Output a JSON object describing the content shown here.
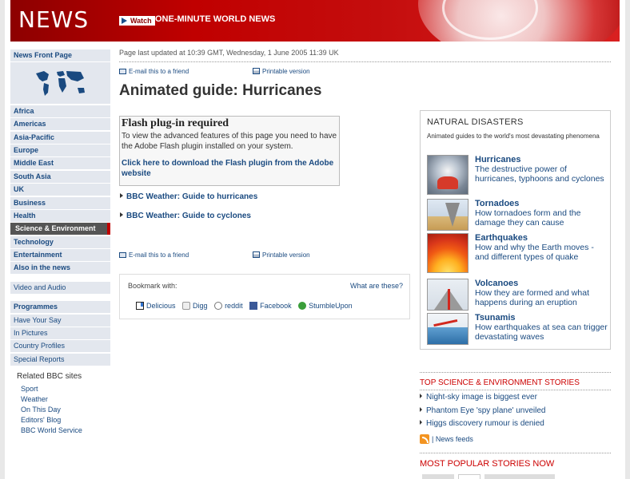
{
  "banner": {
    "logo": "NEWS",
    "watch_label": "Watch",
    "title": "ONE-MINUTE WORLD NEWS"
  },
  "leftnav": {
    "front_page": "News Front Page",
    "sections": [
      "Africa",
      "Americas",
      "Asia-Pacific",
      "Europe",
      "Middle East",
      "South Asia",
      "UK",
      "Business",
      "Health",
      "Science & Environment",
      "Technology",
      "Entertainment",
      "Also in the news"
    ],
    "active": "Science & Environment",
    "video": "Video and Audio",
    "extras": [
      "Programmes",
      "Have Your Say",
      "In Pictures",
      "Country Profiles",
      "Special Reports"
    ],
    "related_title": "Related BBC sites",
    "related": [
      "Sport",
      "Weather",
      "On This Day",
      "Editors' Blog",
      "BBC World Service"
    ]
  },
  "article": {
    "updated": "Page last updated at 10:39 GMT, Wednesday, 1 June 2005 11:39 UK",
    "email": "E-mail this to a friend",
    "print": "Printable version",
    "headline": "Animated guide: Hurricanes",
    "flash_title": "Flash plug-in required",
    "flash_text": "To view the advanced features of this page you need to have the Adobe Flash plugin installed on your system.",
    "flash_link": "Click here to download the Flash plugin from the Adobe website",
    "links": [
      "BBC Weather: Guide to hurricanes",
      "BBC Weather: Guide to cyclones"
    ]
  },
  "bookmark": {
    "label": "Bookmark with:",
    "what": "What are these?",
    "services": [
      "Delicious",
      "Digg",
      "reddit",
      "Facebook",
      "StumbleUpon"
    ]
  },
  "natural_disasters": {
    "title": "NATURAL DISASTERS",
    "subtitle": "Animated guides to the world's most devastating phenomena",
    "items": [
      {
        "name": "Hurricanes",
        "desc": "The destructive power of hurricanes, typhoons and cyclones"
      },
      {
        "name": "Tornadoes",
        "desc": "How tornadoes form and the damage they can cause"
      },
      {
        "name": "Earthquakes",
        "desc": "How and why the Earth moves - and different types of quake"
      },
      {
        "name": "Volcanoes",
        "desc": "How they are formed and what happens during an eruption"
      },
      {
        "name": "Tsunamis",
        "desc": "How earthquakes at sea can trigger devastating waves"
      }
    ]
  },
  "top_stories": {
    "title": "TOP SCIENCE & ENVIRONMENT STORIES",
    "items": [
      "Night-sky image is biggest ever",
      "Phantom Eye 'spy plane' unveiled",
      "Higgs discovery rumour is denied"
    ],
    "feeds": "| News feeds"
  },
  "popular": {
    "title": "MOST POPULAR STORIES NOW"
  },
  "colors": {
    "brand_red": "#c00000",
    "link_blue": "#1a4a80",
    "nav_bg": "#e3e7ee"
  }
}
